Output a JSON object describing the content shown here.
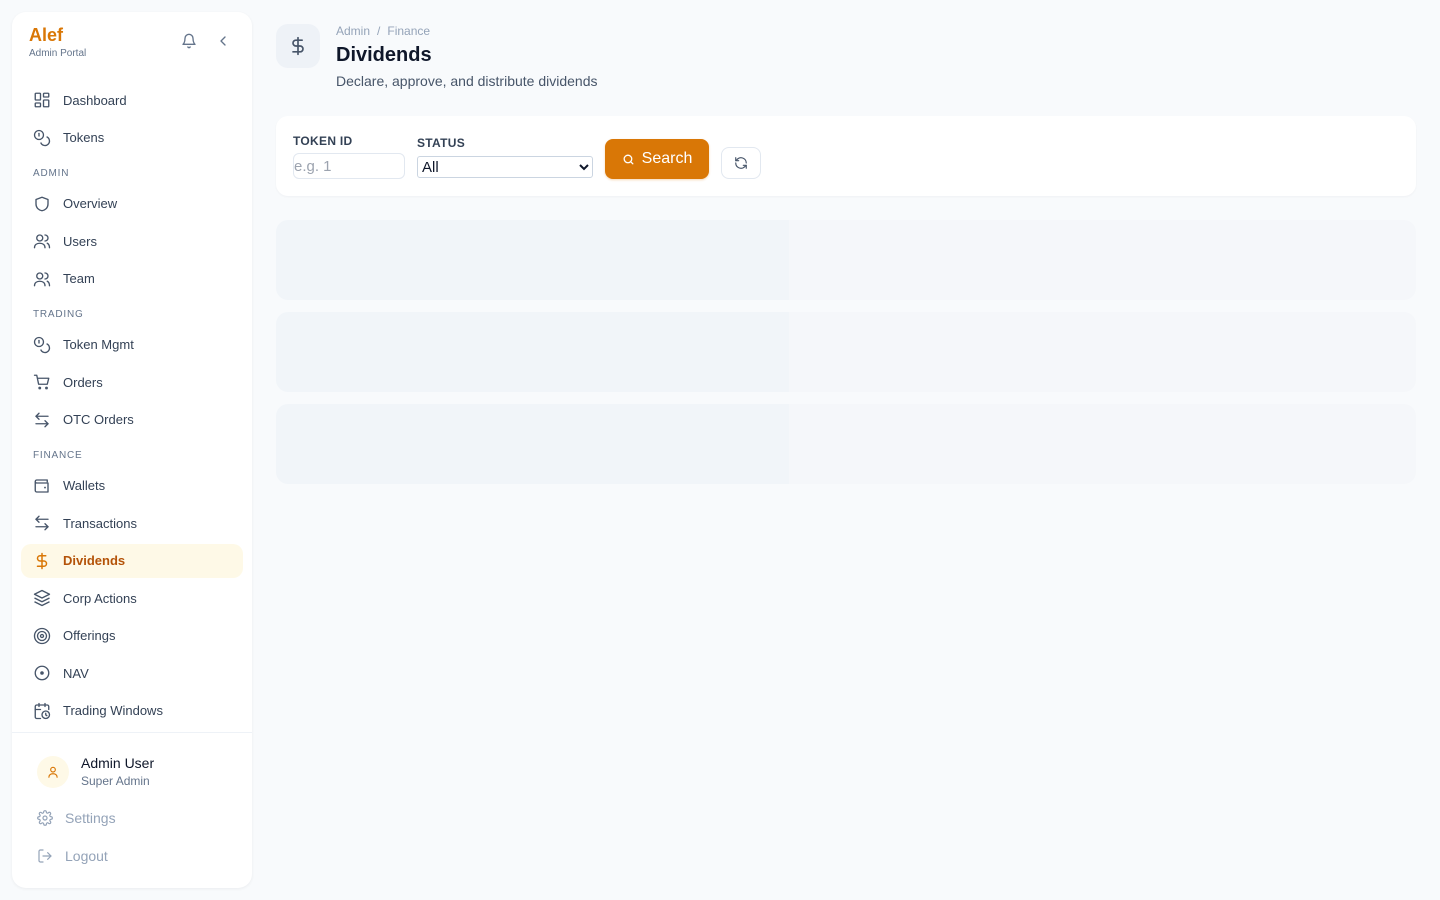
{
  "brand": {
    "name": "Alef",
    "subtitle": "Admin Portal"
  },
  "nav": {
    "items_top": [
      {
        "label": "Dashboard",
        "icon": "grid-icon"
      },
      {
        "label": "Tokens",
        "icon": "coins-icon"
      }
    ],
    "sections": [
      {
        "title": "ADMIN",
        "items": [
          {
            "label": "Overview",
            "icon": "shield-icon"
          },
          {
            "label": "Users",
            "icon": "users-icon"
          },
          {
            "label": "Team",
            "icon": "users-icon"
          }
        ]
      },
      {
        "title": "TRADING",
        "items": [
          {
            "label": "Token Mgmt",
            "icon": "coins-icon"
          },
          {
            "label": "Orders",
            "icon": "cart-icon"
          },
          {
            "label": "OTC Orders",
            "icon": "arrows-exchange-icon"
          }
        ]
      },
      {
        "title": "FINANCE",
        "items": [
          {
            "label": "Wallets",
            "icon": "wallet-icon"
          },
          {
            "label": "Transactions",
            "icon": "arrows-exchange-icon"
          },
          {
            "label": "Dividends",
            "icon": "dollar-icon",
            "active": true
          },
          {
            "label": "Corp Actions",
            "icon": "layers-icon"
          },
          {
            "label": "Offerings",
            "icon": "target-icon"
          },
          {
            "label": "NAV",
            "icon": "circle-dot-icon"
          },
          {
            "label": "Trading Windows",
            "icon": "calendar-clock-icon"
          }
        ]
      }
    ]
  },
  "user": {
    "name": "Admin User",
    "role": "Super Admin"
  },
  "footer": {
    "settings_label": "Settings",
    "logout_label": "Logout"
  },
  "page": {
    "breadcrumb": [
      "Admin",
      "Finance"
    ],
    "title": "Dividends",
    "subtitle": "Declare, approve, and distribute dividends"
  },
  "filters": {
    "token_id_label": "TOKEN ID",
    "token_id_placeholder": "e.g. 1",
    "token_id_value": "",
    "status_label": "STATUS",
    "status_selected": "All",
    "search_label": "Search"
  },
  "colors": {
    "accent": "#d97706",
    "active_bg": "#fef9e7",
    "page_bg": "#f8fafc"
  }
}
